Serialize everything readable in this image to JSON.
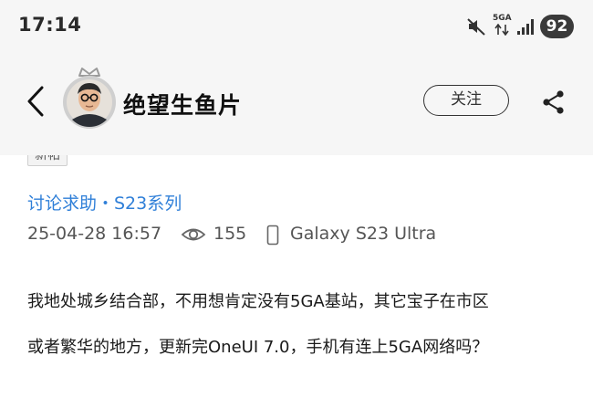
{
  "status_bar": {
    "time": "17:14",
    "network_label": "5GA",
    "battery": "92",
    "icons": [
      "mute-icon",
      "data-arrows-icon",
      "signal-icon"
    ]
  },
  "header": {
    "back_icon": "back-chevron-icon",
    "author_name": "绝望生鱼片",
    "follow_label": "关注",
    "share_icon": "share-icon"
  },
  "post": {
    "tag": "新帖",
    "category": "讨论求助・S23系列",
    "date": "25-04-28 16:57",
    "views": "155",
    "device": "Galaxy S23 Ultra",
    "body_lines": [
      "我地处城乡结合部，不用想肯定没有5GA基站，其它宝子在市区",
      "或者繁华的地方，更新完OneUI 7.0，手机有连上5GA网络吗？"
    ]
  },
  "colors": {
    "header_bg": "#f6f6f6",
    "accent_blue": "#2f7fd8",
    "meta_gray": "#555555",
    "battery_bg": "#3a3a3a"
  }
}
